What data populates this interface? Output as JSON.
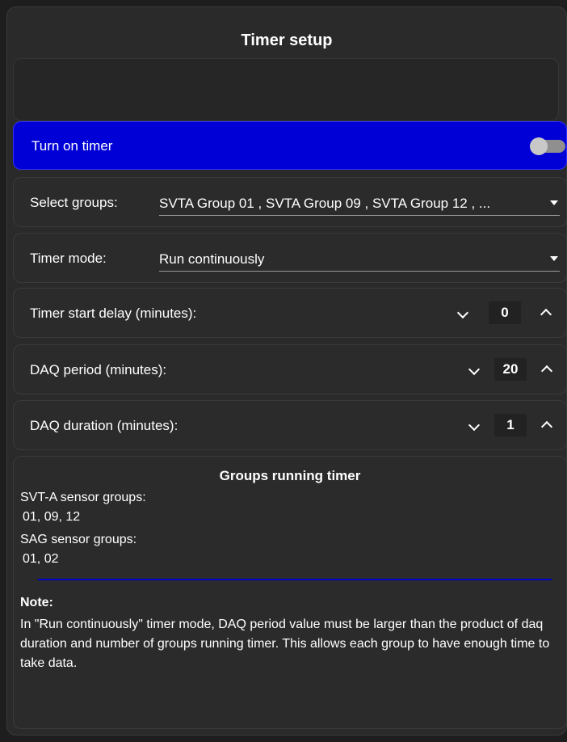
{
  "header": {
    "title": "Timer setup"
  },
  "timer_toggle": {
    "label": "Turn on timer",
    "state": "off"
  },
  "select_groups": {
    "label": "Select groups:",
    "value": "SVTA Group 01 , SVTA Group 09 , SVTA Group 12 , ..."
  },
  "timer_mode": {
    "label": "Timer mode:",
    "value": "Run continuously"
  },
  "start_delay": {
    "label": "Timer start delay (minutes):",
    "value": "0"
  },
  "daq_period": {
    "label": "DAQ period (minutes):",
    "value": "20"
  },
  "daq_duration": {
    "label": "DAQ duration (minutes):",
    "value": "1"
  },
  "groups_running": {
    "heading": "Groups running timer",
    "svta_label": "SVT-A sensor groups:",
    "svta_value": "01, 09, 12",
    "sag_label": "SAG sensor groups:",
    "sag_value": "01, 02"
  },
  "note": {
    "title": "Note:",
    "text": "In \"Run continuously\" timer mode, DAQ period value must be larger than the product of daq duration and number of groups running timer. This allows each group to have enough time to take data."
  },
  "colors": {
    "accent": "#0000d6",
    "background": "#2a2a2a",
    "divider": "#0000c8"
  },
  "icons": {
    "dropdown": "caret-down-icon",
    "decrement": "chevron-down-icon",
    "increment": "chevron-up-icon"
  }
}
